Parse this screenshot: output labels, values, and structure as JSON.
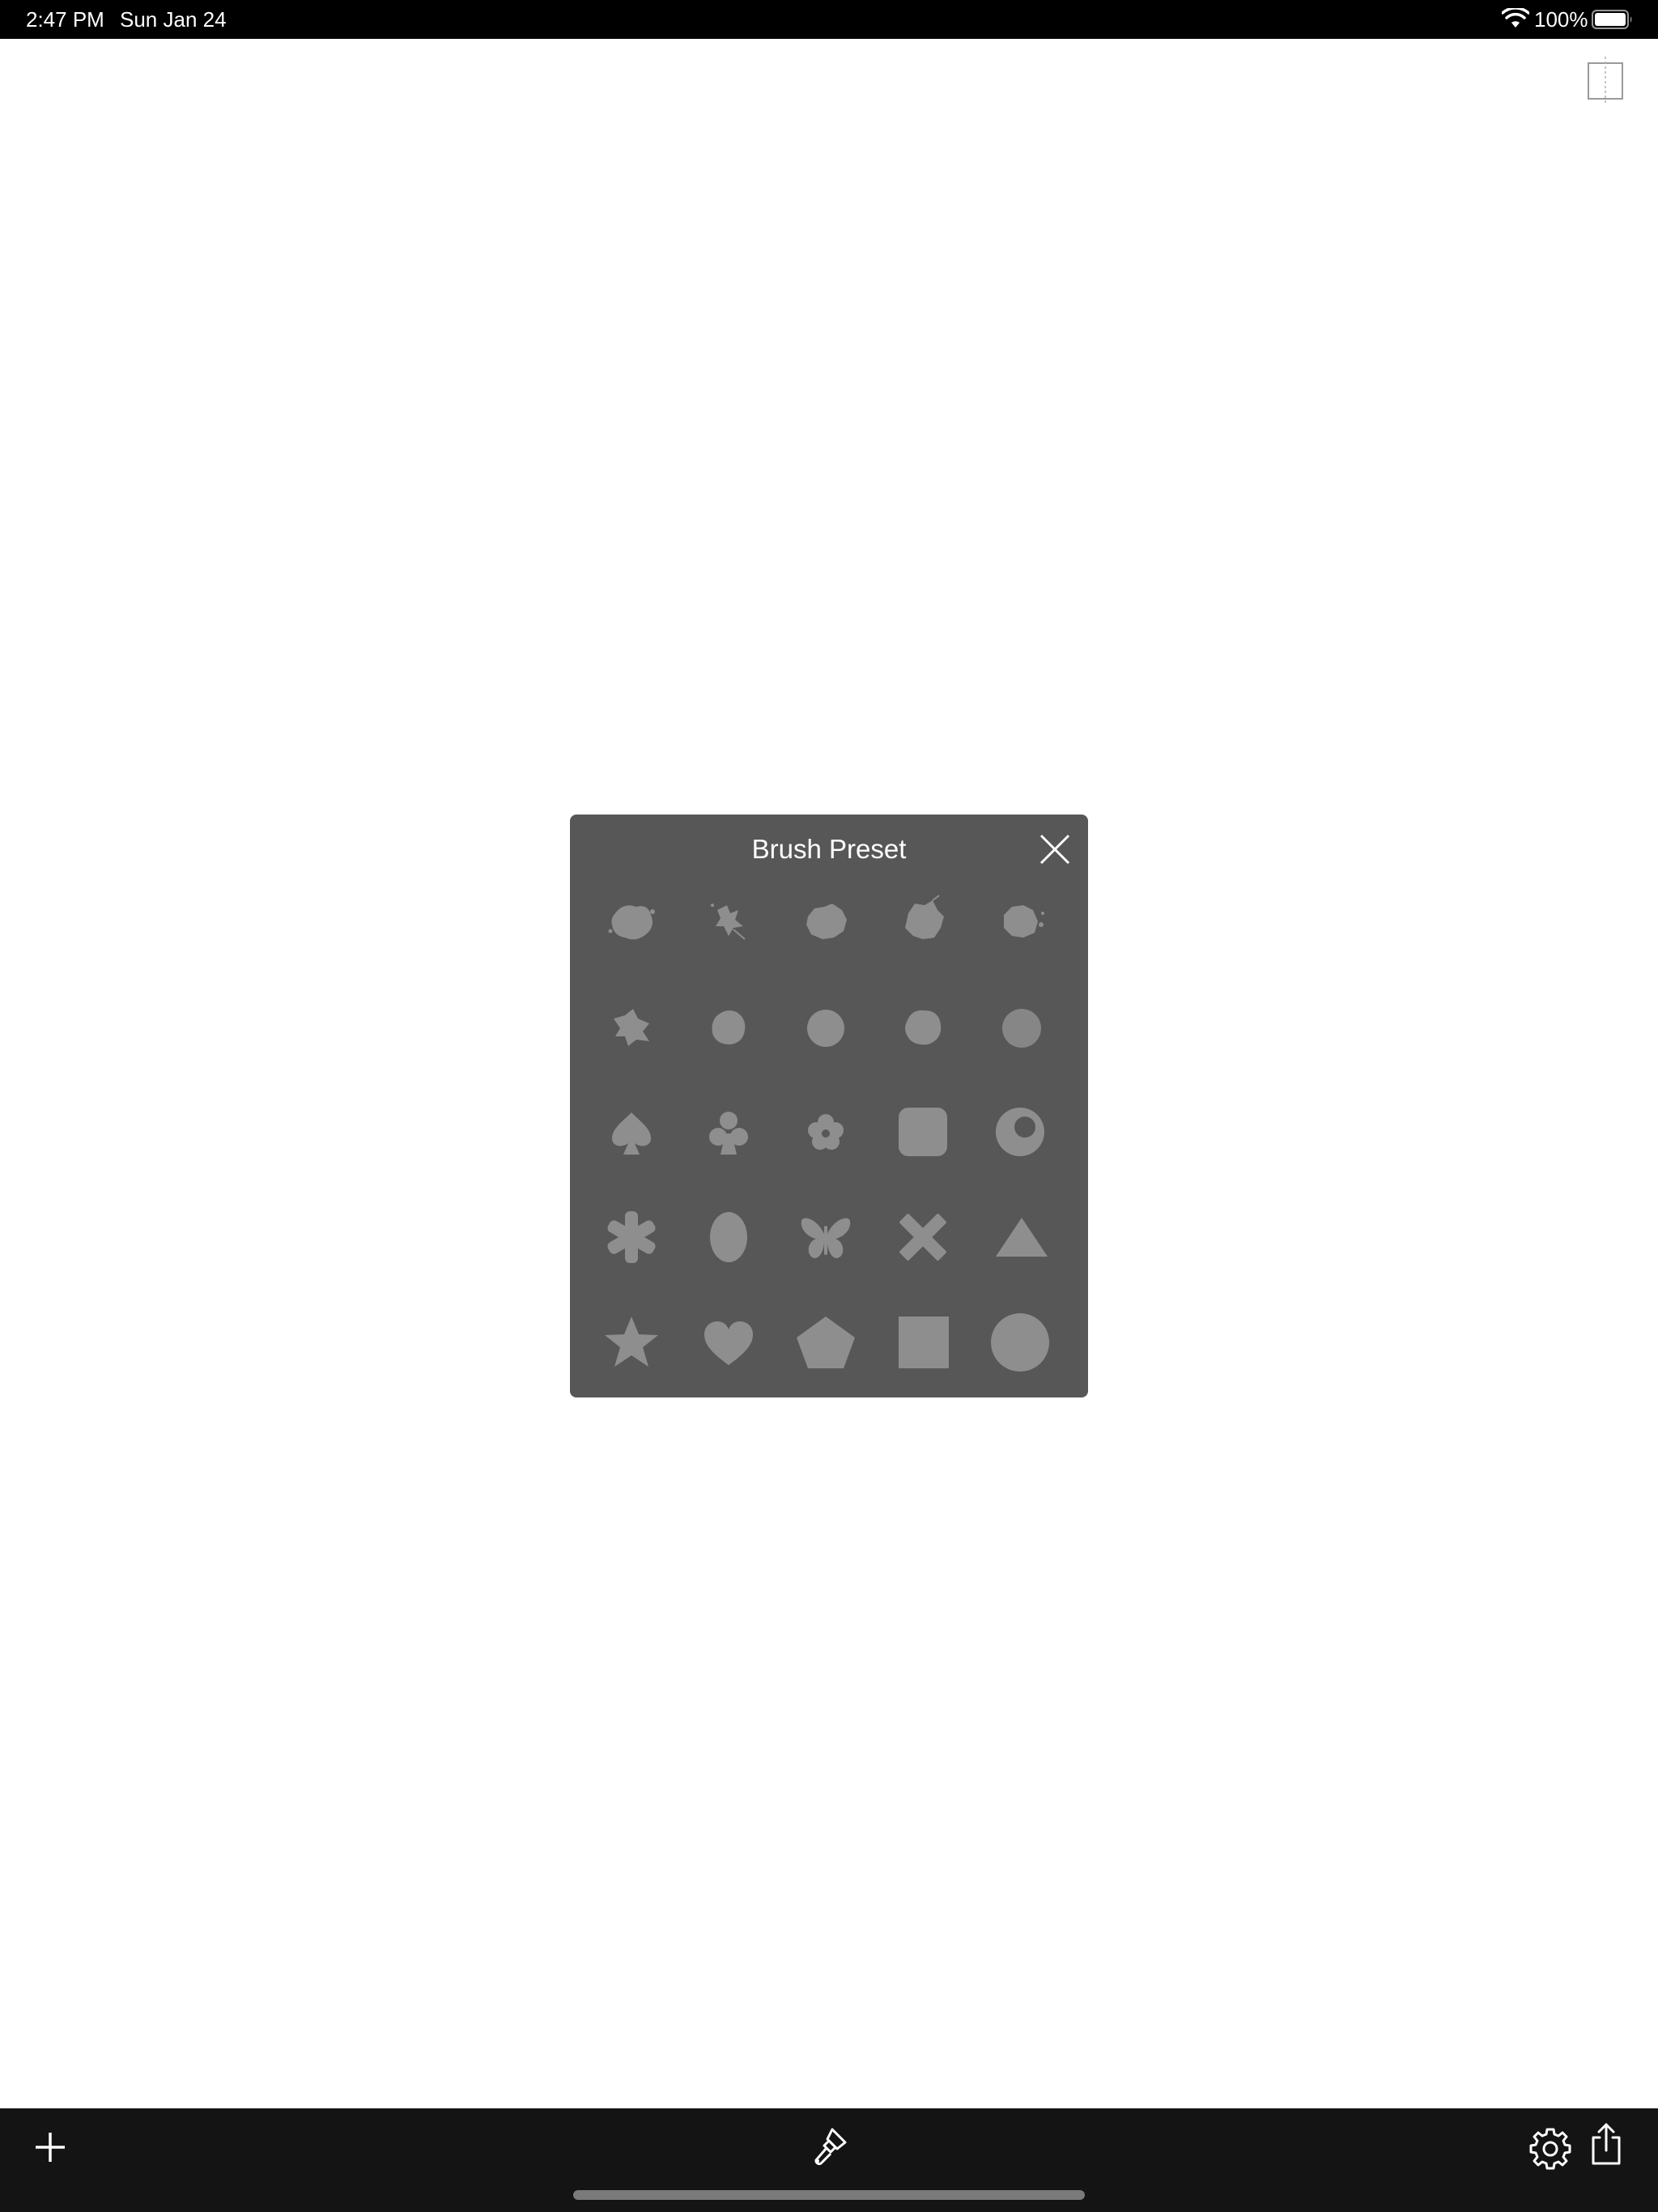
{
  "status_bar": {
    "time": "2:47 PM",
    "date": "Sun Jan 24",
    "battery_text": "100%",
    "icons": [
      "wifi-icon",
      "battery-icon"
    ]
  },
  "canvas": {
    "corner_icon": "split-view-icon"
  },
  "brush_preset_panel": {
    "title": "Brush Preset",
    "close_icon": "close-icon",
    "presets": [
      [
        "splatter-1",
        "splatter-2",
        "splatter-3",
        "splatter-4",
        "splatter-5"
      ],
      [
        "splatter-6",
        "blob-1",
        "blob-2",
        "blob-3",
        "soft-blob"
      ],
      [
        "spade",
        "club",
        "flower",
        "rounded-square",
        "ring"
      ],
      [
        "asterisk",
        "oval",
        "butterfly",
        "x-cross",
        "triangle"
      ],
      [
        "star",
        "heart",
        "pentagon",
        "square",
        "circle"
      ]
    ]
  },
  "toolbar": {
    "icons": [
      "add-icon",
      "brush-icon",
      "gear-icon",
      "share-icon"
    ]
  },
  "colors": {
    "panel_bg": "#575757",
    "shape_fill": "#8e8e8e",
    "toolbar_bg": "#141414"
  }
}
